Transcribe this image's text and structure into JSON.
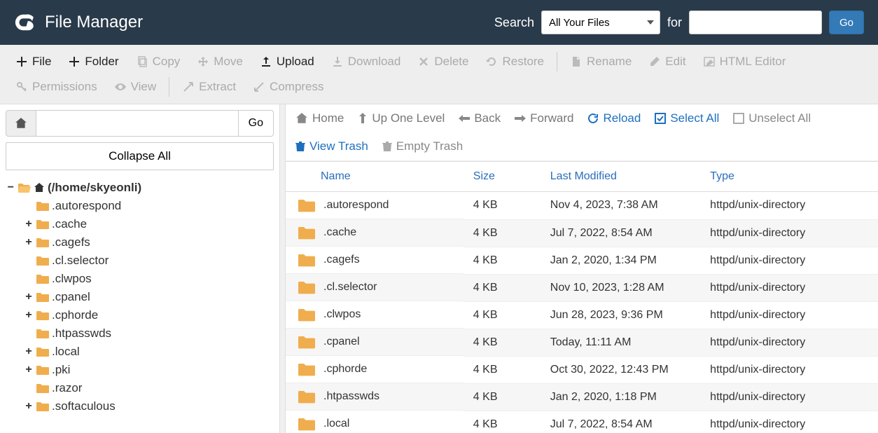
{
  "header": {
    "title": "File Manager",
    "search_label": "Search",
    "for_label": "for",
    "scope_selected": "All Your Files",
    "go": "Go"
  },
  "toolbar": {
    "file": "File",
    "folder": "Folder",
    "copy": "Copy",
    "move": "Move",
    "upload": "Upload",
    "download": "Download",
    "delete": "Delete",
    "restore": "Restore",
    "rename": "Rename",
    "edit": "Edit",
    "html_editor": "HTML Editor",
    "permissions": "Permissions",
    "view": "View",
    "extract": "Extract",
    "compress": "Compress"
  },
  "sidebar": {
    "go": "Go",
    "collapse_all": "Collapse All",
    "root_label": "(/home/skyeonli)",
    "tree": [
      {
        "label": ".autorespond",
        "expandable": false
      },
      {
        "label": ".cache",
        "expandable": true
      },
      {
        "label": ".cagefs",
        "expandable": true
      },
      {
        "label": ".cl.selector",
        "expandable": false
      },
      {
        "label": ".clwpos",
        "expandable": false
      },
      {
        "label": ".cpanel",
        "expandable": true
      },
      {
        "label": ".cphorde",
        "expandable": true
      },
      {
        "label": ".htpasswds",
        "expandable": false
      },
      {
        "label": ".local",
        "expandable": true
      },
      {
        "label": ".pki",
        "expandable": true
      },
      {
        "label": ".razor",
        "expandable": false
      },
      {
        "label": ".softaculous",
        "expandable": true
      }
    ]
  },
  "content_toolbar": {
    "home": "Home",
    "up": "Up One Level",
    "back": "Back",
    "forward": "Forward",
    "reload": "Reload",
    "select_all": "Select All",
    "unselect_all": "Unselect All",
    "view_trash": "View Trash",
    "empty_trash": "Empty Trash"
  },
  "table": {
    "columns": {
      "name": "Name",
      "size": "Size",
      "modified": "Last Modified",
      "type": "Type"
    },
    "rows": [
      {
        "name": ".autorespond",
        "size": "4 KB",
        "modified": "Nov 4, 2023, 7:38 AM",
        "type": "httpd/unix-directory"
      },
      {
        "name": ".cache",
        "size": "4 KB",
        "modified": "Jul 7, 2022, 8:54 AM",
        "type": "httpd/unix-directory"
      },
      {
        "name": ".cagefs",
        "size": "4 KB",
        "modified": "Jan 2, 2020, 1:34 PM",
        "type": "httpd/unix-directory"
      },
      {
        "name": ".cl.selector",
        "size": "4 KB",
        "modified": "Nov 10, 2023, 1:28 AM",
        "type": "httpd/unix-directory"
      },
      {
        "name": ".clwpos",
        "size": "4 KB",
        "modified": "Jun 28, 2023, 9:36 PM",
        "type": "httpd/unix-directory"
      },
      {
        "name": ".cpanel",
        "size": "4 KB",
        "modified": "Today, 11:11 AM",
        "type": "httpd/unix-directory"
      },
      {
        "name": ".cphorde",
        "size": "4 KB",
        "modified": "Oct 30, 2022, 12:43 PM",
        "type": "httpd/unix-directory"
      },
      {
        "name": ".htpasswds",
        "size": "4 KB",
        "modified": "Jan 2, 2020, 1:18 PM",
        "type": "httpd/unix-directory"
      },
      {
        "name": ".local",
        "size": "4 KB",
        "modified": "Jul 7, 2022, 8:54 AM",
        "type": "httpd/unix-directory"
      }
    ]
  }
}
